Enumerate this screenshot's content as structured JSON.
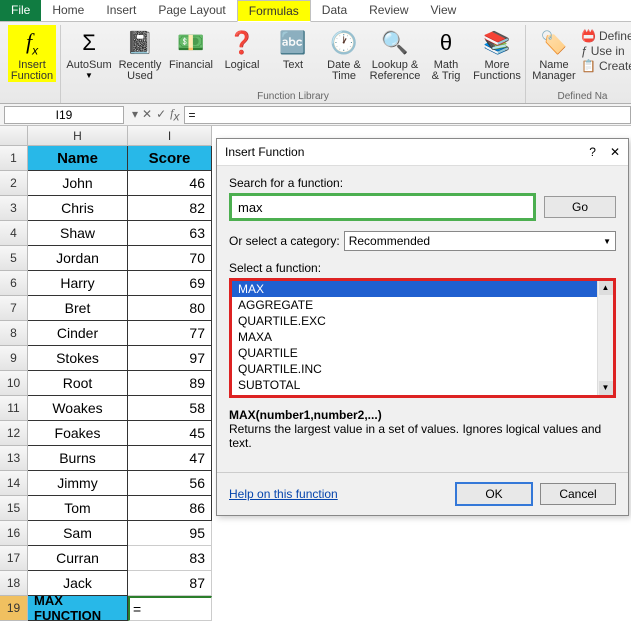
{
  "tabs": {
    "file": "File",
    "home": "Home",
    "insert": "Insert",
    "pagelayout": "Page Layout",
    "formulas": "Formulas",
    "data": "Data",
    "review": "Review",
    "view": "View"
  },
  "ribbon": {
    "insertfn": "Insert\nFunction",
    "autosum": "AutoSum",
    "recently": "Recently\nUsed",
    "financial": "Financial",
    "logical": "Logical",
    "text": "Text",
    "datetime": "Date &\nTime",
    "lookup": "Lookup &\nReference",
    "math": "Math\n& Trig",
    "more": "More\nFunctions",
    "name": "Name\nManager",
    "grp1": "Function Library",
    "grp2": "Defined Na",
    "define": "Define",
    "usein": "Use in",
    "create": "Create"
  },
  "namebox": "I19",
  "formula": "=",
  "cols": {
    "h": "H",
    "i": "I"
  },
  "table": {
    "hdr": {
      "name": "Name",
      "score": "Score"
    },
    "rows": [
      {
        "n": "John",
        "s": "46"
      },
      {
        "n": "Chris",
        "s": "82"
      },
      {
        "n": "Shaw",
        "s": "63"
      },
      {
        "n": "Jordan",
        "s": "70"
      },
      {
        "n": "Harry",
        "s": "69"
      },
      {
        "n": "Bret",
        "s": "80"
      },
      {
        "n": "Cinder",
        "s": "77"
      },
      {
        "n": "Stokes",
        "s": "97"
      },
      {
        "n": "Root",
        "s": "89"
      },
      {
        "n": "Woakes",
        "s": "58"
      },
      {
        "n": "Foakes",
        "s": "45"
      },
      {
        "n": "Burns",
        "s": "47"
      },
      {
        "n": "Jimmy",
        "s": "56"
      },
      {
        "n": "Tom",
        "s": "86"
      },
      {
        "n": "Sam",
        "s": "95"
      },
      {
        "n": "Curran",
        "s": "83"
      },
      {
        "n": "Jack",
        "s": "87"
      }
    ],
    "footer": "MAX FUNCTION",
    "footval": "="
  },
  "dlg": {
    "title": "Insert Function",
    "searchlbl": "Search for a function:",
    "search": "max",
    "go": "Go",
    "catlbl": "Or select a category:",
    "cat": "Recommended",
    "sellbl": "Select a function:",
    "funcs": [
      "MAX",
      "AGGREGATE",
      "QUARTILE.EXC",
      "MAXA",
      "QUARTILE",
      "QUARTILE.INC",
      "SUBTOTAL"
    ],
    "sig": "MAX(number1,number2,...)",
    "desc": "Returns the largest value in a set of values. Ignores logical values and text.",
    "help": "Help on this function",
    "ok": "OK",
    "cancel": "Cancel"
  }
}
